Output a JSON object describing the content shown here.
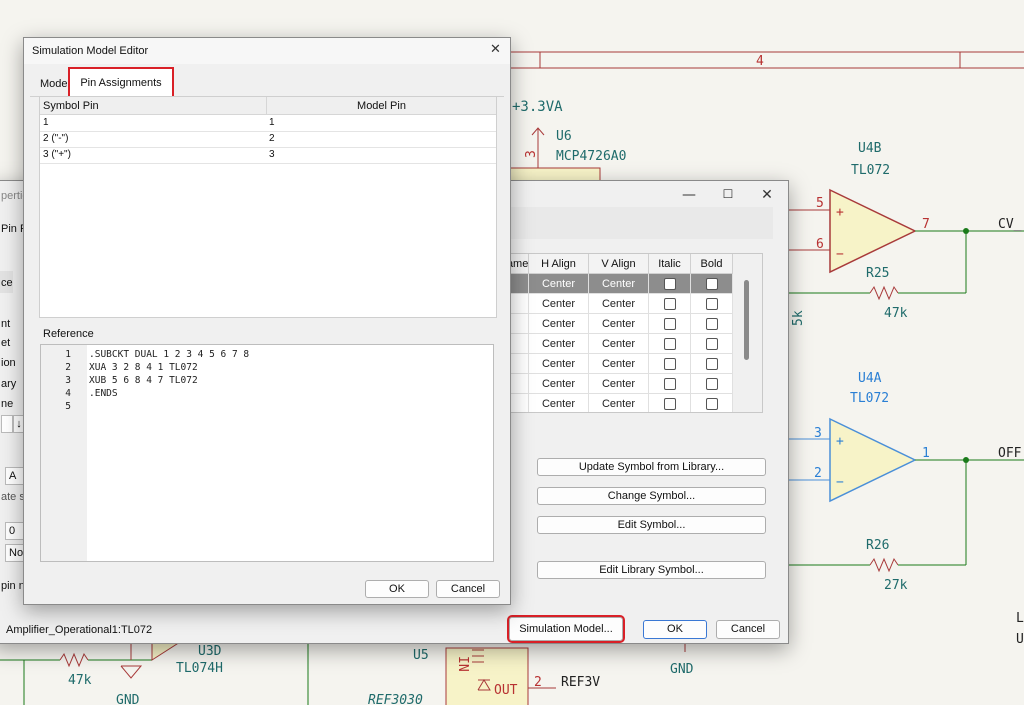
{
  "schematic": {
    "top_box_label": "4",
    "power_label": "+3.3VA",
    "u6": {
      "ref": "U6",
      "value": "MCP4726A0",
      "pin": "3"
    },
    "u4b": {
      "ref": "U4B",
      "value": "TL072",
      "pin_plus": "5",
      "pin_minus": "6",
      "pin_out": "7",
      "net": "CV_"
    },
    "r25": {
      "ref": "R25",
      "value": "47k"
    },
    "u4a": {
      "ref": "U4A",
      "value": "TL072",
      "pin_plus": "3",
      "pin_minus": "2",
      "pin_out": "1",
      "net": "OFF"
    },
    "r26": {
      "ref": "R26",
      "value": "27k"
    },
    "u3d": {
      "ref": "U3D",
      "value": "TL074H"
    },
    "left_r": {
      "value": "47k"
    },
    "gnd1": "GND",
    "gnd2": "GND",
    "u5": {
      "ref": "U5",
      "value": "REF3030",
      "pin_in": "IN",
      "pin_out": "OUT",
      "pin_num": "2",
      "net": "REF3V"
    },
    "right_edge_a": "L",
    "right_edge_b": "U",
    "side_mark": "5k"
  },
  "props_dialog": {
    "title_frag": "pertie",
    "tab_frag": "Pin Fu",
    "left_labels": [
      "ce",
      "nt",
      "et",
      "ion",
      "ary",
      "ne"
    ],
    "left_field_a": "A",
    "left_frag": "ate s",
    "left_field_0": "0",
    "left_field_not": "Not",
    "pin_frag": "pin n",
    "status_text": "Amplifier_Operational1:TL072",
    "grid": {
      "columns": [
        "Name",
        "H Align",
        "V Align",
        "Italic",
        "Bold"
      ],
      "rows": [
        {
          "h": "Center",
          "v": "Center"
        },
        {
          "h": "Center",
          "v": "Center"
        },
        {
          "h": "Center",
          "v": "Center"
        },
        {
          "h": "Center",
          "v": "Center"
        },
        {
          "h": "Center",
          "v": "Center"
        },
        {
          "h": "Center",
          "v": "Center"
        },
        {
          "h": "Center",
          "v": "Center"
        }
      ]
    },
    "buttons": {
      "update": "Update Symbol from Library...",
      "change": "Change Symbol...",
      "edit": "Edit Symbol...",
      "edit_lib": "Edit Library Symbol...",
      "sim_model": "Simulation Model...",
      "ok": "OK",
      "cancel": "Cancel"
    },
    "controls": {
      "min": "—",
      "max": "☐",
      "close": "✕"
    }
  },
  "sim_editor": {
    "title": "Simulation Model Editor",
    "close": "✕",
    "tabs": {
      "model": "Mode",
      "pins": "Pin Assignments"
    },
    "pin_table": {
      "headers": {
        "symbol": "Symbol Pin",
        "model": "Model Pin"
      },
      "rows": [
        {
          "symbol": "1",
          "model": "1"
        },
        {
          "symbol": "2 (\"-\")",
          "model": "2"
        },
        {
          "symbol": "3 (\"+\")",
          "model": "3"
        }
      ]
    },
    "reference_label": "Reference",
    "code_lines": [
      {
        "n": "1",
        "text": ".SUBCKT DUAL 1 2 3 4 5 6 7 8"
      },
      {
        "n": "2",
        "text": "XUA 3 2 8 4 1 TL072"
      },
      {
        "n": "3",
        "text": "XUB 5 6 8 4 7 TL072"
      },
      {
        "n": "4",
        "text": ".ENDS"
      },
      {
        "n": "5",
        "text": ""
      }
    ],
    "ok": "OK",
    "cancel": "Cancel"
  }
}
